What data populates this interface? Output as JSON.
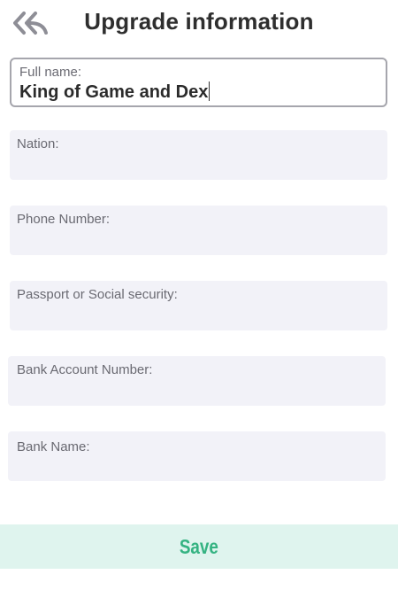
{
  "header": {
    "title": "Upgrade information",
    "back_icon": "double-chevron-back-icon"
  },
  "form": {
    "full_name": {
      "label": "Full name:",
      "value": "King of Game and Dex"
    },
    "nation": {
      "label": "Nation:",
      "value": ""
    },
    "phone": {
      "label": "Phone Number:",
      "value": ""
    },
    "passport": {
      "label": "Passport or Social security:",
      "value": ""
    },
    "bank_account": {
      "label": "Bank Account Number:",
      "value": ""
    },
    "bank_name": {
      "label": "Bank Name:",
      "value": ""
    }
  },
  "save": {
    "label": "Save",
    "color": "#35b382",
    "background": "#dff4ee"
  }
}
